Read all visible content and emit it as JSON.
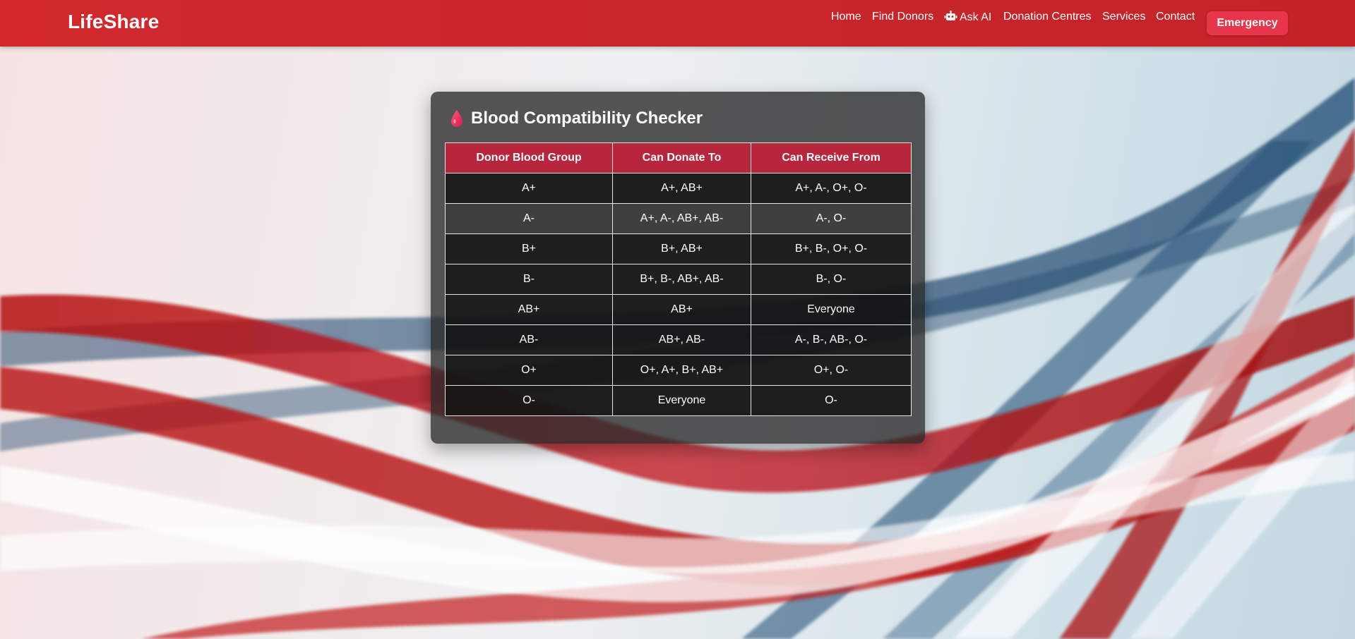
{
  "brand": "LifeShare",
  "nav": {
    "home": "Home",
    "find_donors": "Find Donors",
    "ask_ai": "Ask AI",
    "donation_centres": "Donation Centres",
    "services": "Services",
    "contact": "Contact",
    "emergency": "Emergency"
  },
  "colors": {
    "navbar": "#c8262b",
    "emergency_button": "#e7364a",
    "table_header": "#b8263b",
    "drop_icon": "#e8335a"
  },
  "checker": {
    "title": "Blood Compatibility Checker",
    "icon": "blood-drop-icon",
    "columns": [
      "Donor Blood Group",
      "Can Donate To",
      "Can Receive From"
    ],
    "rows": [
      [
        "A+",
        "A+, AB+",
        "A+, A-, O+, O-"
      ],
      [
        "A-",
        "A+, A-, AB+, AB-",
        "A-, O-"
      ],
      [
        "B+",
        "B+, AB+",
        "B+, B-, O+, O-"
      ],
      [
        "B-",
        "B+, B-, AB+, AB-",
        "B-, O-"
      ],
      [
        "AB+",
        "AB+",
        "Everyone"
      ],
      [
        "AB-",
        "AB+, AB-",
        "A-, B-, AB-, O-"
      ],
      [
        "O+",
        "O+, A+, B+, AB+",
        "O+, O-"
      ],
      [
        "O-",
        "Everyone",
        "O-"
      ]
    ]
  }
}
